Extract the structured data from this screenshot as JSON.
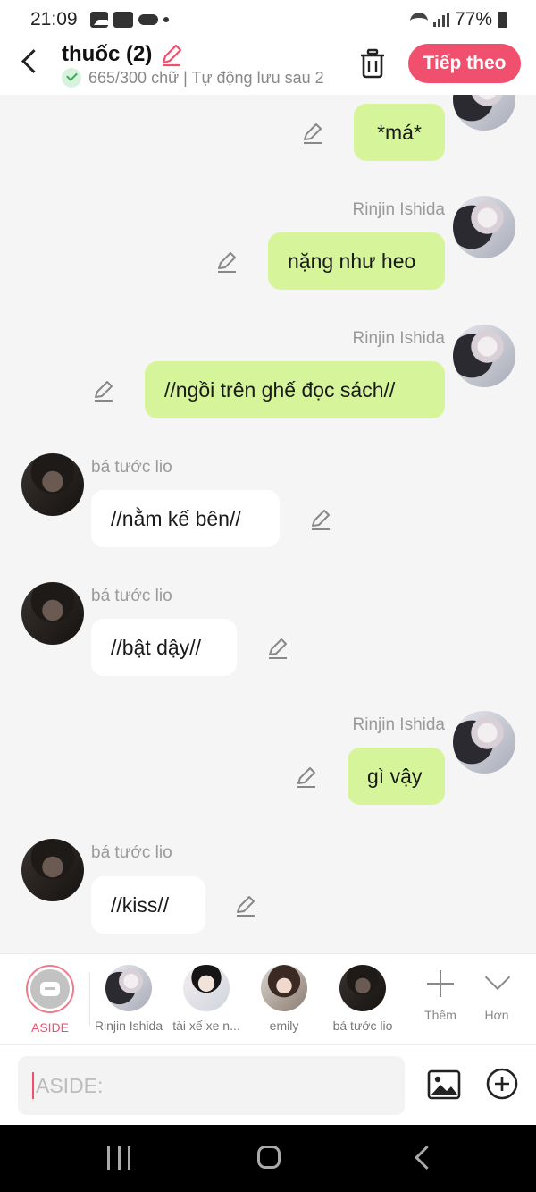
{
  "status": {
    "time": "21:09",
    "battery": "77%"
  },
  "header": {
    "title": "thuốc (2)",
    "subtitle": "665/300 chữ | Tự động lưu sau 2",
    "next_label": "Tiếp theo"
  },
  "messages": [
    {
      "sender": "",
      "text": "*má*",
      "side": "me"
    },
    {
      "sender": "Rinjin Ishida",
      "text": "nặng như heo",
      "side": "me"
    },
    {
      "sender": "Rinjin Ishida",
      "text": "//ngồi trên ghế đọc sách//",
      "side": "me"
    },
    {
      "sender": "bá tước lio",
      "text": "//nằm kế bên//",
      "side": "other"
    },
    {
      "sender": "bá tước lio",
      "text": "//bật dậy//",
      "side": "other"
    },
    {
      "sender": "Rinjin Ishida",
      "text": "gì vậy",
      "side": "me"
    },
    {
      "sender": "bá tước lio",
      "text": "//kiss//",
      "side": "other"
    }
  ],
  "characters": [
    {
      "label": "ASIDE"
    },
    {
      "label": "Rinjin Ishida"
    },
    {
      "label": "tài xế xe n..."
    },
    {
      "label": "emily"
    },
    {
      "label": "bá tước lio"
    }
  ],
  "tools": {
    "add_label": "Thêm",
    "more_label": "Hơn"
  },
  "input": {
    "placeholder": "ASIDE:"
  },
  "colors": {
    "accent": "#f0506e",
    "my_bubble": "#d6f59a",
    "other_bubble": "#ffffff"
  }
}
